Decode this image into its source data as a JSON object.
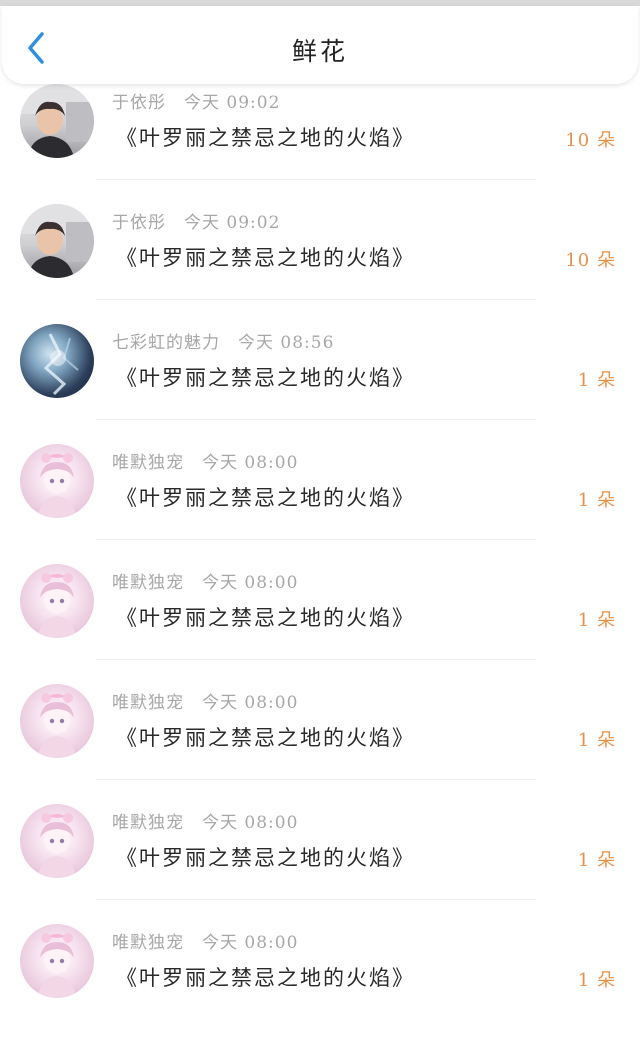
{
  "header": {
    "title": "鲜花",
    "back_icon": "chevron-left-icon",
    "accent_color": "#2f8fe0"
  },
  "rows": [
    {
      "user": "于依彤",
      "time": "今天 09:02",
      "gift": "《叶罗丽之禁忌之地的火焰》",
      "qty": "10 朵",
      "avatar": "photo"
    },
    {
      "user": "于依彤",
      "time": "今天 09:02",
      "gift": "《叶罗丽之禁忌之地的火焰》",
      "qty": "10 朵",
      "avatar": "photo"
    },
    {
      "user": "七彩虹的魅力",
      "time": "今天 08:56",
      "gift": "《叶罗丽之禁忌之地的火焰》",
      "qty": "1 朵",
      "avatar": "art"
    },
    {
      "user": "唯默独宠",
      "time": "今天 08:00",
      "gift": "《叶罗丽之禁忌之地的火焰》",
      "qty": "1 朵",
      "avatar": "anime"
    },
    {
      "user": "唯默独宠",
      "time": "今天 08:00",
      "gift": "《叶罗丽之禁忌之地的火焰》",
      "qty": "1 朵",
      "avatar": "anime"
    },
    {
      "user": "唯默独宠",
      "time": "今天 08:00",
      "gift": "《叶罗丽之禁忌之地的火焰》",
      "qty": "1 朵",
      "avatar": "anime"
    },
    {
      "user": "唯默独宠",
      "time": "今天 08:00",
      "gift": "《叶罗丽之禁忌之地的火焰》",
      "qty": "1 朵",
      "avatar": "anime"
    },
    {
      "user": "唯默独宠",
      "time": "今天 08:00",
      "gift": "《叶罗丽之禁忌之地的火焰》",
      "qty": "1 朵",
      "avatar": "anime"
    }
  ],
  "colors": {
    "quantity": "#e8914a",
    "meta": "#a7a7a7",
    "text": "#2a2a2a"
  }
}
